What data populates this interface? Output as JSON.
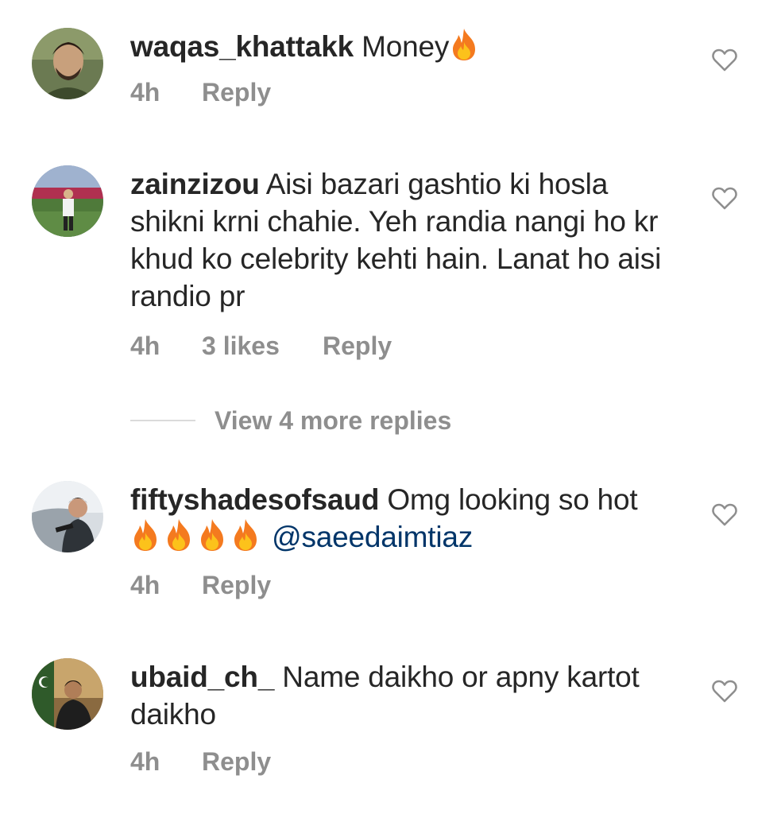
{
  "comments": [
    {
      "username": "waqas_khattakk",
      "text": "Money",
      "emoji": [
        "fire"
      ],
      "time": "4h",
      "likes": "",
      "reply": "Reply",
      "liked": false,
      "icon": "heart-outline-icon"
    },
    {
      "username": "zainzizou",
      "text": "Aisi bazari gashtio ki hosla shikni krni chahie. Yeh randia nangi ho kr khud ko celebrity kehti hain. Lanat ho aisi randio pr",
      "time": "4h",
      "likes": "3 likes",
      "reply": "Reply",
      "liked": false,
      "icon": "heart-outline-icon"
    },
    {
      "username": "fiftyshadesofsaud",
      "text": "Omg looking so hot",
      "emoji": [
        "fire",
        "fire",
        "fire",
        "fire"
      ],
      "mention": "@saeedaimtiaz",
      "time": "4h",
      "reply": "Reply",
      "liked": false,
      "icon": "heart-outline-icon"
    },
    {
      "username": "ubaid_ch_",
      "text": "Name daikho or apny kartot daikho",
      "time": "4h",
      "reply": "Reply",
      "liked": false,
      "icon": "heart-outline-icon"
    }
  ],
  "view_replies": {
    "label": "View 4 more replies"
  },
  "colors": {
    "text": "#262626",
    "meta": "#8e8e8e",
    "mention": "#003569",
    "divider": "#dbdbdb"
  }
}
